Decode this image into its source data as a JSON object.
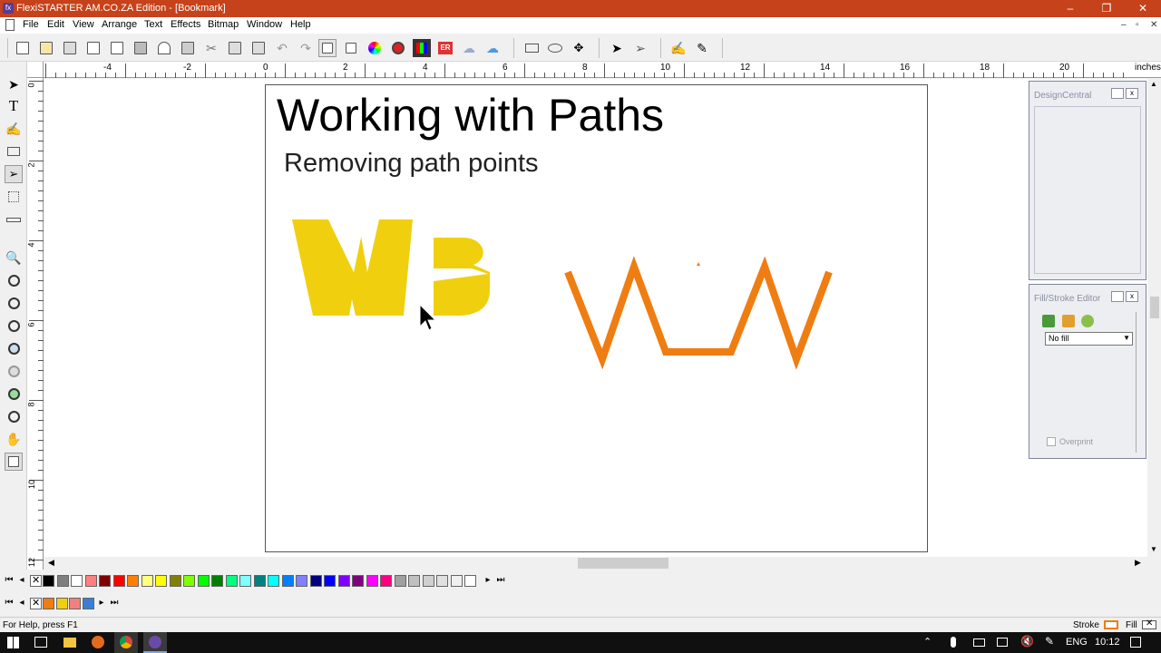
{
  "window": {
    "title": "FlexiSTARTER AM.CO.ZA Edition - [Bookmark]",
    "minimize": "–",
    "restore": "❐",
    "close": "✕"
  },
  "menu": {
    "items": [
      "File",
      "Edit",
      "View",
      "Arrange",
      "Text",
      "Effects",
      "Bitmap",
      "Window",
      "Help"
    ],
    "mdi_minimize": "–",
    "mdi_restore": "▫",
    "mdi_close": "✕"
  },
  "ruler": {
    "h_labels": [
      "-4",
      "-2",
      "0",
      "2",
      "4",
      "6",
      "8",
      "10",
      "12",
      "14",
      "16",
      "18",
      "20"
    ],
    "unit": "inches",
    "v_labels": [
      "0",
      "2",
      "4",
      "6",
      "8",
      "10",
      "12"
    ]
  },
  "document": {
    "title": "Working with Paths",
    "subtitle": "Removing path points",
    "wp_color": "#f0d00e",
    "w_path_color": "#ef7d12"
  },
  "design_central": {
    "title": "DesignCentral"
  },
  "fill_stroke": {
    "title": "Fill/Stroke Editor",
    "fill_select": "No fill",
    "overprint_label": "Overprint"
  },
  "palette": {
    "colors": [
      "#000000",
      "#7f7f7f",
      "#ffffff",
      "#ff8080",
      "#800000",
      "#ff0000",
      "#ff8000",
      "#ffff80",
      "#ffff00",
      "#808000",
      "#80ff00",
      "#00ff00",
      "#008000",
      "#00ff80",
      "#80ffff",
      "#008080",
      "#00ffff",
      "#0080ff",
      "#8080ff",
      "#000080",
      "#0000ff",
      "#8000ff",
      "#800080",
      "#ff00ff",
      "#ff0080",
      "#a0a0a0",
      "#c0c0c0",
      "#d0d0d0",
      "#e0e0e0",
      "#f0f0f0",
      "#ffffff"
    ],
    "doc_colors": [
      "#ef7d12",
      "#f0d00e",
      "#f08080",
      "#3a7fd5"
    ]
  },
  "status": {
    "help": "For Help, press F1",
    "stroke_label": "Stroke",
    "fill_label": "Fill",
    "stroke_color": "#ef7d12"
  },
  "taskbar": {
    "lang": "ENG",
    "time": "10:12"
  }
}
